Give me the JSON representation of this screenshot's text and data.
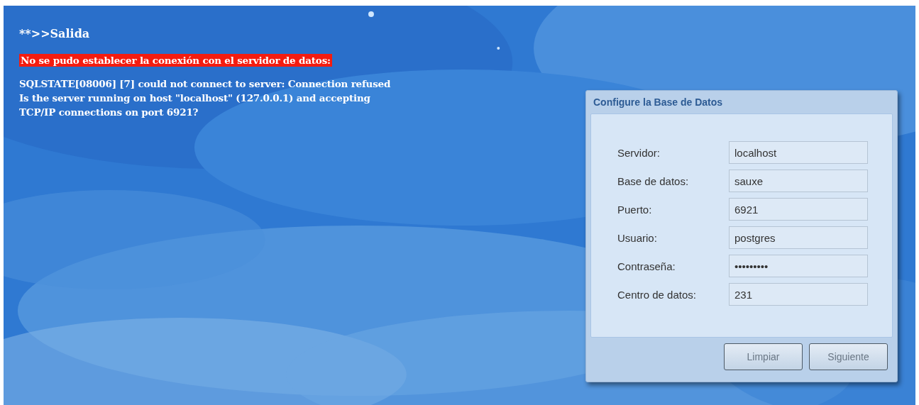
{
  "output": {
    "heading": "**>>Salida",
    "error_banner": "No se pudo establecer la conexión con el servidor de datos:",
    "message_lines": [
      "SQLSTATE[08006] [7] could not connect to server: Connection refused",
      "Is the server running on host \"localhost\" (127.0.0.1) and accepting",
      "TCP/IP connections on port 6921?"
    ]
  },
  "dialog": {
    "title": "Configure la Base de Datos",
    "fields": [
      {
        "label": "Servidor:",
        "value": "localhost"
      },
      {
        "label": "Base de datos:",
        "value": "sauxe"
      },
      {
        "label": "Puerto:",
        "value": "6921"
      },
      {
        "label": "Usuario:",
        "value": "postgres"
      },
      {
        "label": "Contraseña:",
        "value": "•••••••••"
      },
      {
        "label": "Centro de datos:",
        "value": "231"
      }
    ],
    "buttons": [
      "Limpiar",
      "Siguiente"
    ]
  }
}
